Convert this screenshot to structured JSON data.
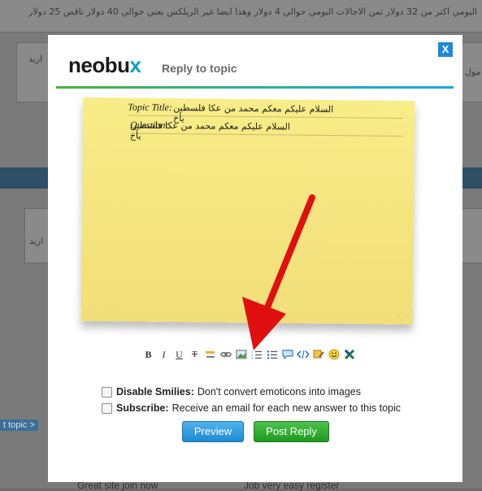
{
  "background": {
    "top_text": "اليومي اكتر من 32 دولار ثمن الاحالات اليومي حوالي 4 دولار وهذا ايضا غير الريلكس يعني حوالي 40 دولار ناقص 25 دولار",
    "side_text_1": "اريد",
    "side_text_2": "مول",
    "side_text_3": "اريد",
    "tag": "t topic >",
    "bottom_left": "Great site join now",
    "bottom_right": "Job very easy register"
  },
  "modal": {
    "close_label": "X",
    "logo": {
      "part1": "neobu",
      "part2": "x"
    },
    "title": "Reply to topic",
    "note": {
      "topic_label": "Topic Title:",
      "topic_value": "السلام عليكم معكم محمد من عكا فلسطين يأخ",
      "question_label": "Question:",
      "question_value": "السلام عليكم معكم محمد من عكا فلسطين يأخ"
    },
    "toolbar": {
      "bold": "B",
      "italic": "I",
      "underline": "U",
      "strike": "T"
    },
    "options": {
      "disable_smilies_label": "Disable Smilies:",
      "disable_smilies_desc": "Don't convert emoticons into images",
      "subscribe_label": "Subscribe:",
      "subscribe_desc": "Receive an email for each new answer to this topic"
    },
    "buttons": {
      "preview": "Preview",
      "post_reply": "Post Reply"
    }
  },
  "colors": {
    "accent_blue": "#1e88d8",
    "accent_green": "#2aa02a",
    "note_yellow": "#f4e37e",
    "arrow_red": "#e01010"
  }
}
